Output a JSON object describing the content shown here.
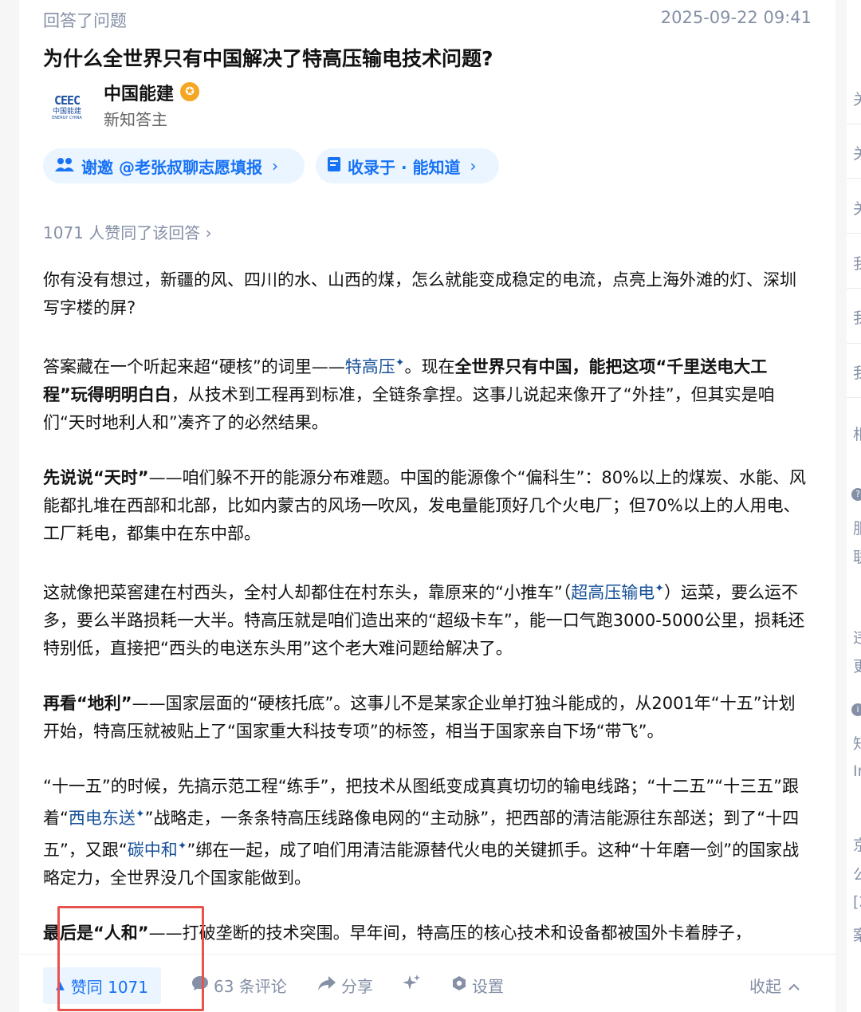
{
  "meta": {
    "label": "回答了问题",
    "timestamp": "2025-09-22 09:41"
  },
  "question": {
    "title": "为什么全世界只有中国解决了特高压输电技术问题?"
  },
  "author": {
    "logo_main": "CEEC",
    "logo_cn": "中国能建",
    "logo_en": "ENERGY CHINA",
    "name": "中国能建",
    "badge_icon": "verified-badge-icon",
    "subtitle": "新知答主"
  },
  "chips": {
    "invite_icon": "users-icon",
    "invite_label": "谢邀 @老张叔聊志愿填报",
    "collect_icon": "bookmark-icon",
    "collect_label": "收录于 · 能知道"
  },
  "vote_summary": "1071 人赞同了该回答 ›",
  "content": {
    "p1": "你有没有想过，新疆的风、四川的水、山西的煤，怎么就能变成稳定的电流，点亮上海外滩的灯、深圳写字楼的屏?",
    "p2_a": "答案藏在一个听起来超“硬核”的词里——",
    "p2_link": "特高压",
    "p2_b": "。现在",
    "p2_bold": "全世界只有中国，能把这项“千里送电大工程”玩得明明白白",
    "p2_c": "，从技术到工程再到标准，全链条拿捏。这事儿说起来像开了“外挂”，但其实是咱们“天时地利人和”凑齐了的必然结果。",
    "p3_bold": "先说说“天时”",
    "p3": "——咱们躲不开的能源分布难题。中国的能源像个“偏科生”：80%以上的煤炭、水能、风能都扎堆在西部和北部，比如内蒙古的风场一吹风，发电量能顶好几个火电厂；但70%以上的人用电、工厂耗电，都集中在东中部。",
    "p4_a": "这就像把菜窖建在村西头，全村人却都住在村东头，靠原来的“小推车”（",
    "p4_link": "超高压输电",
    "p4_b": "）运菜，要么运不多，要么半路损耗一大半。特高压就是咱们造出来的“超级卡车”，能一口气跑3000-5000公里，损耗还特别低，直接把“西头的电送东头用”这个老大难问题给解决了。",
    "p5_bold": "再看“地利”",
    "p5": "——国家层面的“硬核托底”。这事儿不是某家企业单打独斗能成的，从2001年“十五”计划开始，特高压就被贴上了“国家重大科技专项”的标签，相当于国家亲自下场“带飞”。",
    "p6_a": "“十一五”的时候，先搞示范工程“练手”，把技术从图纸变成真真切切的输电线路；“十二五”“十三五”跟着“",
    "p6_link1": "西电东送",
    "p6_b": "”战略走，一条条特高压线路像电网的“主动脉”，把西部的清洁能源往东部送；到了“十四五”，又跟“",
    "p6_link2": "碳中和",
    "p6_c": "”绑在一起，成了咱们用清洁能源替代火电的关键抓手。这种“十年磨一剑”的国家战略定力，全世界没几个国家能做到。",
    "p7_bold": "最后是“人和”",
    "p7": "——打破垄断的技术突围。早年间，特高压的核心技术和设备都被国外卡着脖子，",
    "spark": "✦"
  },
  "actions": {
    "vote_label": "赞同 1071",
    "comment_label": "63 条评论",
    "share_label": "分享",
    "settings_label": "设置",
    "collapse_label": "收起"
  },
  "right_rail": {
    "items": [
      "关",
      "关",
      "关",
      "我",
      "我",
      "我",
      "相",
      "服",
      "联",
      "违",
      "更",
      "知",
      "In",
      "京",
      "公",
      "[2",
      "案"
    ]
  },
  "colors": {
    "accent": "#1772f6",
    "link": "#175199",
    "muted": "#8590a6",
    "highlight": "#e8524d"
  }
}
